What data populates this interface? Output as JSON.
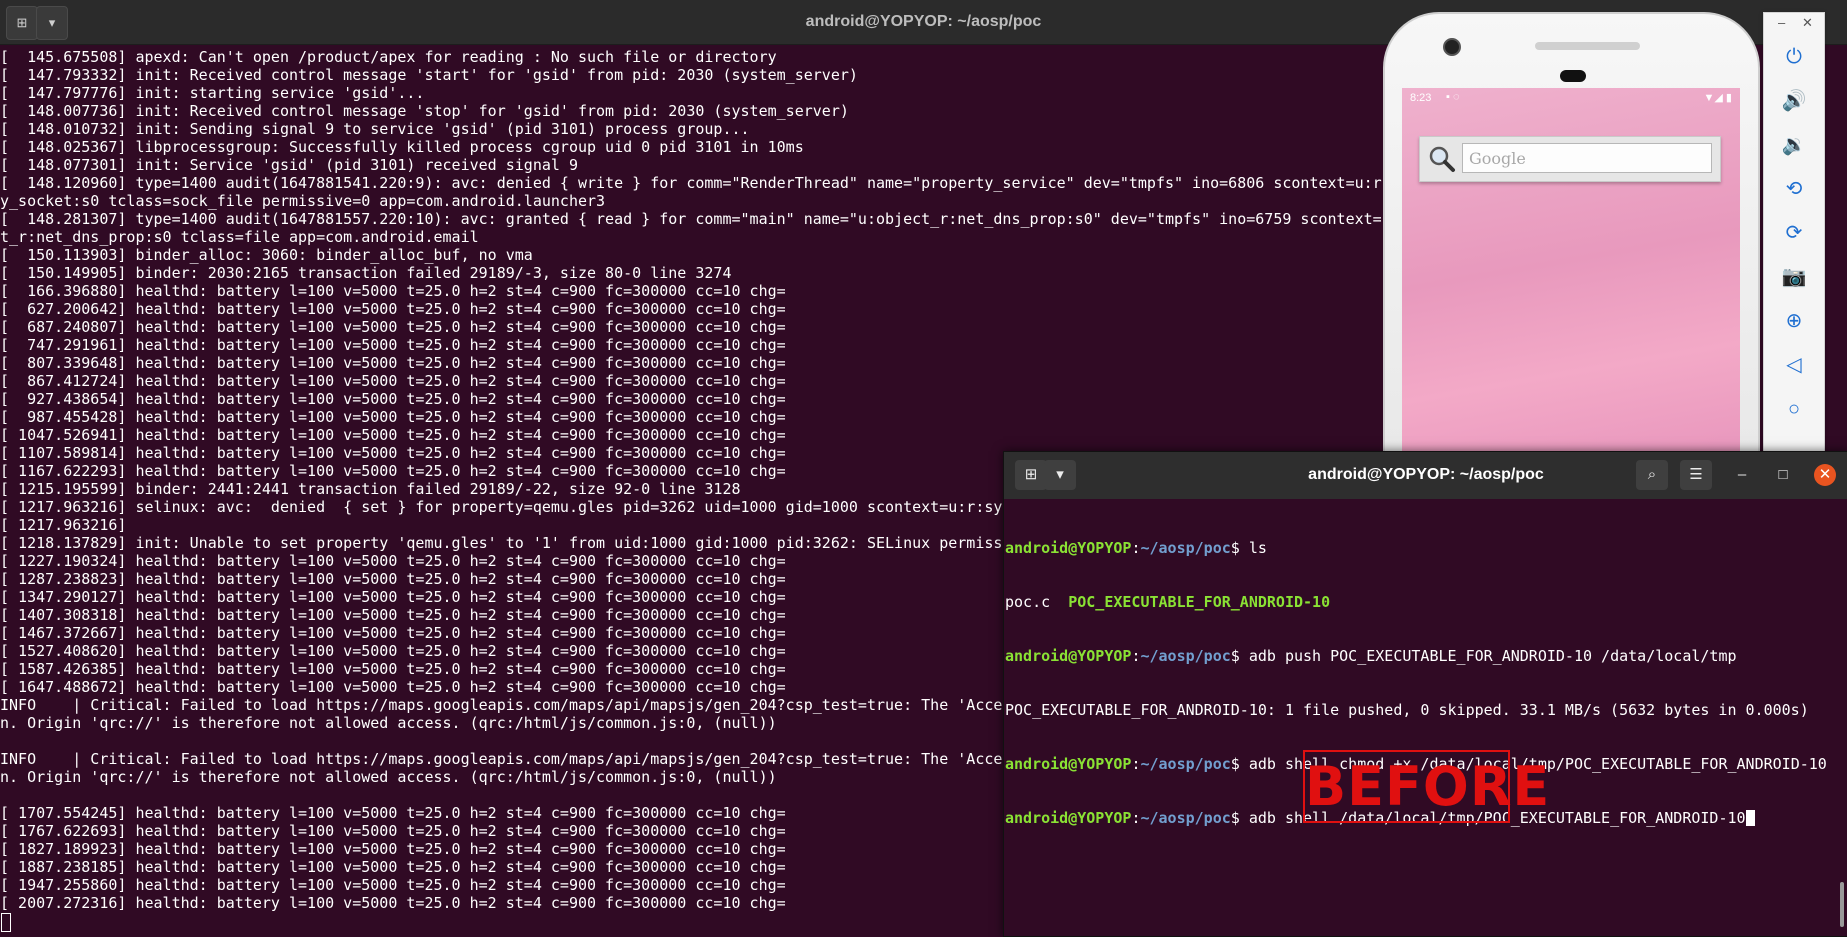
{
  "back_terminal": {
    "title": "android@YOPYOP: ~/aosp/poc",
    "lines": [
      "[  145.675508] apexd: Can't open /product/apex for reading : No such file or directory",
      "[  147.793332] init: Received control message 'start' for 'gsid' from pid: 2030 (system_server)",
      "[  147.797776] init: starting service 'gsid'...",
      "[  148.007736] init: Received control message 'stop' for 'gsid' from pid: 2030 (system_server)",
      "[  148.010732] init: Sending signal 9 to service 'gsid' (pid 3101) process group...",
      "[  148.025367] libprocessgroup: Successfully killed process cgroup uid 0 pid 3101 in 10ms",
      "[  148.077301] init: Service 'gsid' (pid 3101) received signal 9",
      "[  148.120960] type=1400 audit(1647881541.220:9): avc: denied { write } for comm=\"RenderThread\" name=\"property_service\" dev=\"tmpfs\" ino=6806 scontext=u:r:",
      "y_socket:s0 tclass=sock_file permissive=0 app=com.android.launcher3",
      "[  148.281307] type=1400 audit(1647881557.220:10): avc: granted { read } for comm=\"main\" name=\"u:object_r:net_dns_prop:s0\" dev=\"tmpfs\" ino=6759 scontext=u",
      "t_r:net_dns_prop:s0 tclass=file app=com.android.email",
      "[  150.113903] binder_alloc: 3060: binder_alloc_buf, no vma",
      "[  150.149905] binder: 2030:2165 transaction failed 29189/-3, size 80-0 line 3274",
      "[  166.396880] healthd: battery l=100 v=5000 t=25.0 h=2 st=4 c=900 fc=300000 cc=10 chg=",
      "[  627.200642] healthd: battery l=100 v=5000 t=25.0 h=2 st=4 c=900 fc=300000 cc=10 chg=",
      "[  687.240807] healthd: battery l=100 v=5000 t=25.0 h=2 st=4 c=900 fc=300000 cc=10 chg=",
      "[  747.291961] healthd: battery l=100 v=5000 t=25.0 h=2 st=4 c=900 fc=300000 cc=10 chg=",
      "[  807.339648] healthd: battery l=100 v=5000 t=25.0 h=2 st=4 c=900 fc=300000 cc=10 chg=",
      "[  867.412724] healthd: battery l=100 v=5000 t=25.0 h=2 st=4 c=900 fc=300000 cc=10 chg=",
      "[  927.438654] healthd: battery l=100 v=5000 t=25.0 h=2 st=4 c=900 fc=300000 cc=10 chg=",
      "[  987.455428] healthd: battery l=100 v=5000 t=25.0 h=2 st=4 c=900 fc=300000 cc=10 chg=",
      "[ 1047.526941] healthd: battery l=100 v=5000 t=25.0 h=2 st=4 c=900 fc=300000 cc=10 chg=",
      "[ 1107.589814] healthd: battery l=100 v=5000 t=25.0 h=2 st=4 c=900 fc=300000 cc=10 chg=",
      "[ 1167.622293] healthd: battery l=100 v=5000 t=25.0 h=2 st=4 c=900 fc=300000 cc=10 chg=",
      "[ 1215.195599] binder: 2441:2441 transaction failed 29189/-22, size 92-0 line 3128",
      "[ 1217.963216] selinux: avc:  denied  { set } for property=qemu.gles pid=3262 uid=1000 gid=1000 scontext=u:r:sys",
      "[ 1217.963216]",
      "[ 1218.137829] init: Unable to set property 'qemu.gles' to '1' from uid:1000 gid:1000 pid:3262: SELinux permiss",
      "[ 1227.190324] healthd: battery l=100 v=5000 t=25.0 h=2 st=4 c=900 fc=300000 cc=10 chg=",
      "[ 1287.238823] healthd: battery l=100 v=5000 t=25.0 h=2 st=4 c=900 fc=300000 cc=10 chg=",
      "[ 1347.290127] healthd: battery l=100 v=5000 t=25.0 h=2 st=4 c=900 fc=300000 cc=10 chg=",
      "[ 1407.308318] healthd: battery l=100 v=5000 t=25.0 h=2 st=4 c=900 fc=300000 cc=10 chg=",
      "[ 1467.372667] healthd: battery l=100 v=5000 t=25.0 h=2 st=4 c=900 fc=300000 cc=10 chg=",
      "[ 1527.408620] healthd: battery l=100 v=5000 t=25.0 h=2 st=4 c=900 fc=300000 cc=10 chg=",
      "[ 1587.426385] healthd: battery l=100 v=5000 t=25.0 h=2 st=4 c=900 fc=300000 cc=10 chg=",
      "[ 1647.488672] healthd: battery l=100 v=5000 t=25.0 h=2 st=4 c=900 fc=300000 cc=10 chg=",
      "INFO    | Critical: Failed to load https://maps.googleapis.com/maps/api/mapsjs/gen_204?csp_test=true: The 'Acces",
      "n. Origin 'qrc://' is therefore not allowed access. (qrc:/html/js/common.js:0, (null))",
      "",
      "INFO    | Critical: Failed to load https://maps.googleapis.com/maps/api/mapsjs/gen_204?csp_test=true: The 'Acces",
      "n. Origin 'qrc://' is therefore not allowed access. (qrc:/html/js/common.js:0, (null))",
      "",
      "[ 1707.554245] healthd: battery l=100 v=5000 t=25.0 h=2 st=4 c=900 fc=300000 cc=10 chg=",
      "[ 1767.622693] healthd: battery l=100 v=5000 t=25.0 h=2 st=4 c=900 fc=300000 cc=10 chg=",
      "[ 1827.189923] healthd: battery l=100 v=5000 t=25.0 h=2 st=4 c=900 fc=300000 cc=10 chg=",
      "[ 1887.238185] healthd: battery l=100 v=5000 t=25.0 h=2 st=4 c=900 fc=300000 cc=10 chg=",
      "[ 1947.255860] healthd: battery l=100 v=5000 t=25.0 h=2 st=4 c=900 fc=300000 cc=10 chg=",
      "[ 2007.272316] healthd: battery l=100 v=5000 t=25.0 h=2 st=4 c=900 fc=300000 cc=10 chg="
    ]
  },
  "emulator": {
    "status_time": "8:23",
    "search_placeholder": "Google",
    "tools": [
      "power-icon",
      "volume-up-icon",
      "volume-down-icon",
      "rotate-left-icon",
      "rotate-right-icon",
      "camera-icon",
      "zoom-icon",
      "back-icon",
      "home-icon"
    ]
  },
  "front_terminal": {
    "title": "android@YOPYOP: ~/aosp/poc",
    "prompt_user": "android@YOPYOP",
    "prompt_path": "~/aosp/poc",
    "commands": {
      "c1": "ls",
      "c2": "adb push POC_EXECUTABLE_FOR_ANDROID-10 /data/local/tmp",
      "c3": "adb shell chmod +x /data/local/tmp/POC_EXECUTABLE_FOR_ANDROID-10",
      "c4": "adb shell /data/local/tmp/POC_EXECUTABLE_FOR_ANDROID-10"
    },
    "ls_file1": "poc.c",
    "ls_file2": "POC_EXECUTABLE_FOR_ANDROID-10",
    "push_output": "POC_EXECUTABLE_FOR_ANDROID-10: 1 file pushed, 0 skipped. 33.1 MB/s (5632 bytes in 0.000s)"
  },
  "overlay_label": "BEFORE",
  "colors": {
    "terminal_bg": "#300a24",
    "prompt_user": "#8ae234",
    "prompt_path": "#729fcf",
    "accent_close": "#e95420",
    "before_red": "#e01010"
  }
}
